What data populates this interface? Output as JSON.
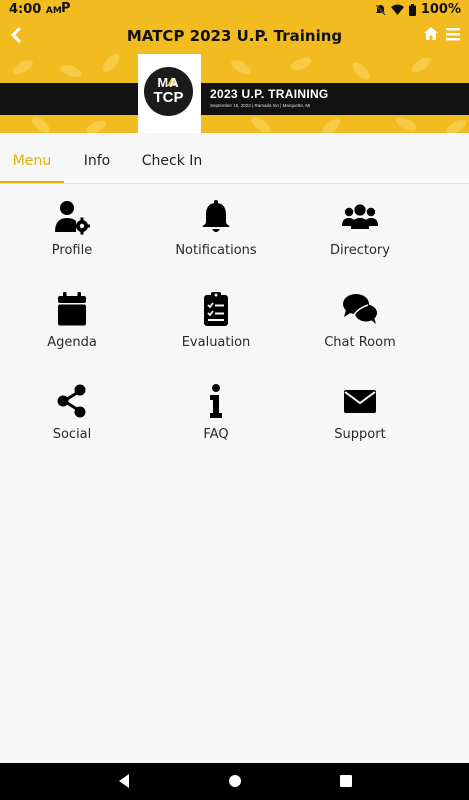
{
  "status_bar": {
    "time": "4:00",
    "ampm": "AM",
    "app_mark": "P",
    "battery": "100%"
  },
  "header": {
    "title": "MATCP 2023 U.P. Training"
  },
  "banner": {
    "logo_line1": "MA",
    "logo_line2": "TCP",
    "title": "2023 U.P. TRAINING",
    "subtitle": "September 15, 2023 | Ramada Inn | Marquette, MI"
  },
  "tabs": [
    {
      "label": "Menu",
      "active": true
    },
    {
      "label": "Info",
      "active": false
    },
    {
      "label": "Check In",
      "active": false
    }
  ],
  "menu": [
    {
      "label": "Profile",
      "icon": "user-gear-icon"
    },
    {
      "label": "Notifications",
      "icon": "bell-icon"
    },
    {
      "label": "Directory",
      "icon": "users-icon"
    },
    {
      "label": "Agenda",
      "icon": "calendar-icon"
    },
    {
      "label": "Evaluation",
      "icon": "clipboard-check-icon"
    },
    {
      "label": "Chat Room",
      "icon": "chat-bubbles-icon"
    },
    {
      "label": "Social",
      "icon": "share-icon"
    },
    {
      "label": "FAQ",
      "icon": "info-icon"
    },
    {
      "label": "Support",
      "icon": "envelope-icon"
    }
  ],
  "colors": {
    "accent": "#f2bb1f",
    "active_tab": "#e9ad00",
    "nav_bar": "#000000"
  }
}
